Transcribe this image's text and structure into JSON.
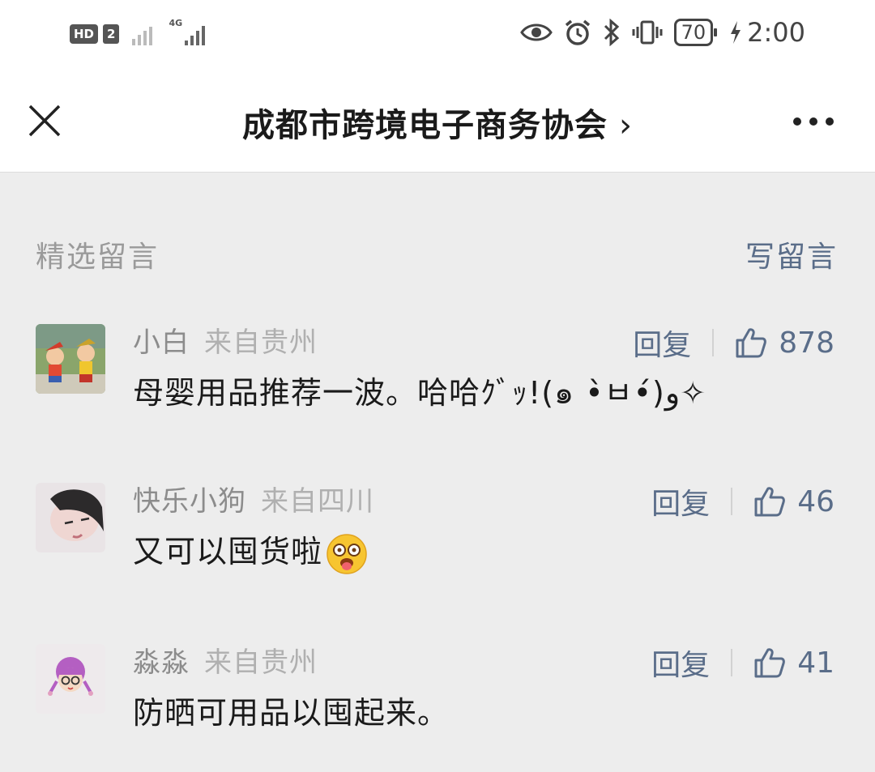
{
  "status": {
    "hd": "HD",
    "sim": "2",
    "net": "4G",
    "battery": "70",
    "time": "2:00"
  },
  "nav": {
    "title": "成都市跨境电子商务协会",
    "chevron": "›",
    "icons": {
      "close": "close-icon",
      "more": "more-icon"
    }
  },
  "section": {
    "title": "精选留言",
    "write_label": "写留言"
  },
  "reply_label": "回复",
  "comments": [
    {
      "name": "小白",
      "location": "来自贵州",
      "likes": "878",
      "text": "母婴用品推荐一波。哈哈ｸﾞｯ!(๑ •̀ㅂ•́)و✧"
    },
    {
      "name": "快乐小狗",
      "location": "来自四川",
      "likes": "46",
      "text": "又可以囤货啦"
    },
    {
      "name": "淼淼",
      "location": "来自贵州",
      "likes": "41",
      "text": "防晒可用品以囤起来。"
    }
  ],
  "colors": {
    "link": "#5a6d89",
    "background": "#ededed",
    "header": "#ffffff"
  }
}
